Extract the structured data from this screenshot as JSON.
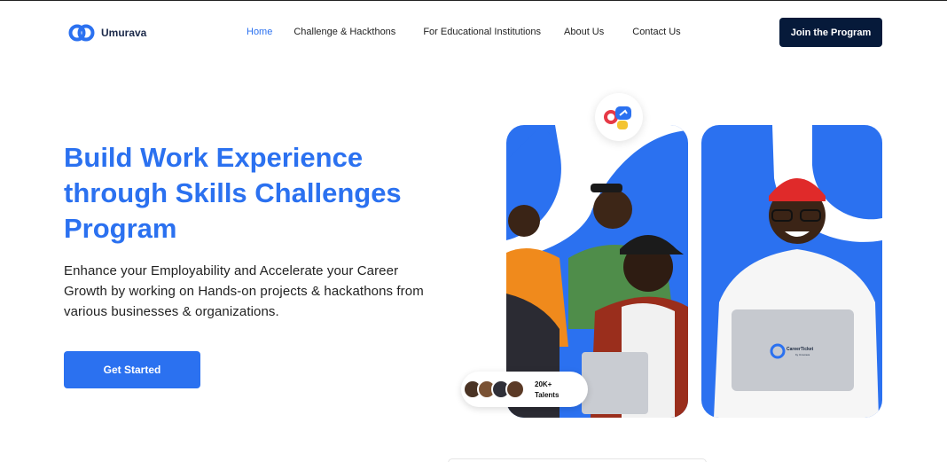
{
  "header": {
    "brand": "Umurava",
    "nav": [
      {
        "label": "Home",
        "active": true
      },
      {
        "label": "Challenge & Hackthons",
        "active": false
      },
      {
        "label": "For Educational Institutions",
        "active": false
      },
      {
        "label": "About Us",
        "active": false
      },
      {
        "label": "Contact Us",
        "active": false
      }
    ],
    "cta_label": "Join the Program"
  },
  "hero": {
    "title": "Build Work Experience through Skills Challenges Program",
    "subtitle": "Enhance your Employability and Accelerate your Career Growth by working on Hands-on projects & hackathons from various businesses & organizations.",
    "cta_label": "Get Started"
  },
  "talents_badge": {
    "count": "20K+",
    "label": "Talents"
  },
  "laptop_brand": {
    "name": "CareerTicket",
    "by": "by Umurava"
  },
  "colors": {
    "accent": "#2b71f0",
    "navy": "#061a3a",
    "text": "#222222"
  },
  "icons": [
    "umurava-logo-icon",
    "chat-bubbles-icon",
    "talent-avatar-icon"
  ]
}
